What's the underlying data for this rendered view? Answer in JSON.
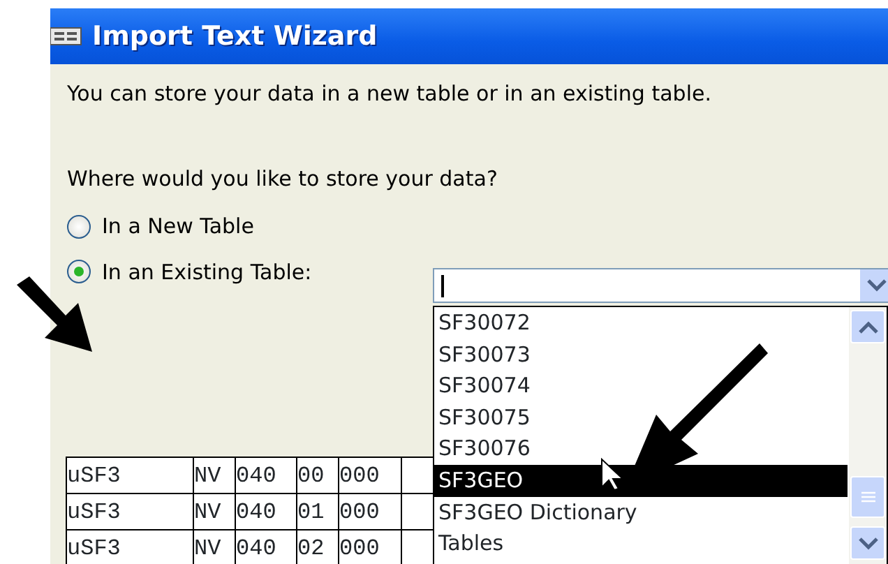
{
  "window": {
    "title": "Import Text Wizard"
  },
  "intro": "You can store your data in a new table or in an existing table.",
  "question": "Where would you like to store your data?",
  "options": [
    {
      "label": "In a New Table",
      "selected": false
    },
    {
      "label": "In an Existing Table:",
      "selected": true
    }
  ],
  "table_combo": {
    "expanded": true
  },
  "dropdown_items": [
    {
      "label": "SF30072",
      "selected": false
    },
    {
      "label": "SF30073",
      "selected": false
    },
    {
      "label": "SF30074",
      "selected": false
    },
    {
      "label": "SF30075",
      "selected": false
    },
    {
      "label": "SF30076",
      "selected": false
    },
    {
      "label": "SF3GEO",
      "selected": true
    },
    {
      "label": "SF3GEO Dictionary",
      "selected": false
    },
    {
      "label": "Tables",
      "selected": false
    }
  ],
  "preview_rows": [
    [
      "uSF3",
      "NV",
      "040",
      "00",
      "000"
    ],
    [
      "uSF3",
      "NV",
      "040",
      "01",
      "000"
    ],
    [
      "uSF3",
      "NV",
      "040",
      "02",
      "000"
    ]
  ]
}
